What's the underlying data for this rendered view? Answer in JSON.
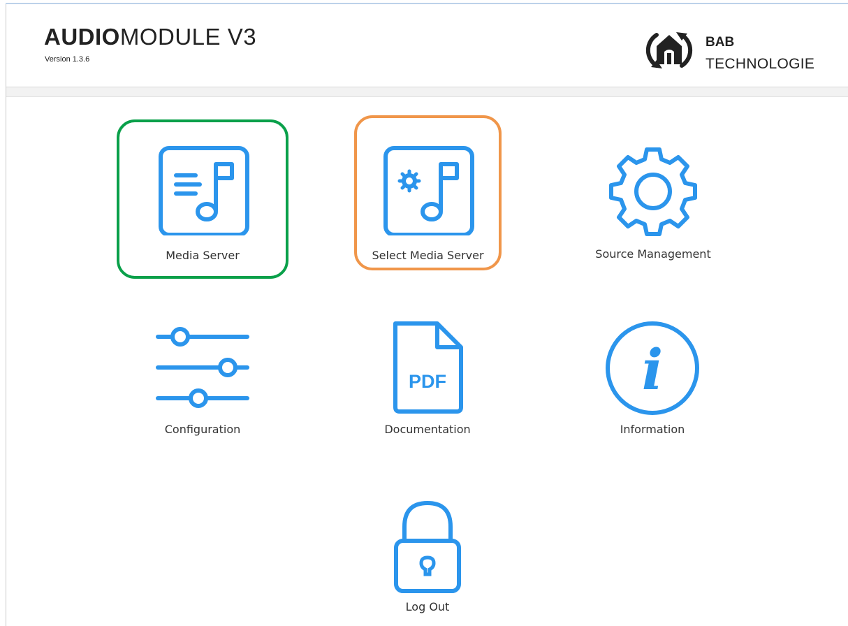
{
  "header": {
    "title_bold": "AUDIO",
    "title_rest": "MODULE V3",
    "version": "Version 1.3.6",
    "logo_line1": "BAB",
    "logo_line2": "TECHNOLOGIE"
  },
  "colors": {
    "icon_blue": "#2b95ec",
    "highlight_green": "#0aa04a",
    "highlight_orange": "#f0964a"
  },
  "tiles": [
    {
      "label": "Media Server",
      "icon": "music-note-list-icon"
    },
    {
      "label": "Select Media Server",
      "icon": "music-note-gear-icon"
    },
    {
      "label": "Source Management",
      "icon": "gear-icon"
    },
    {
      "label": "Configuration",
      "icon": "sliders-icon"
    },
    {
      "label": "Documentation",
      "icon": "pdf-icon"
    },
    {
      "label": "Information",
      "icon": "info-icon"
    },
    {
      "label": "Log Out",
      "icon": "lock-icon"
    }
  ],
  "pdf_icon_text": "PDF",
  "info_icon_glyph": "i"
}
